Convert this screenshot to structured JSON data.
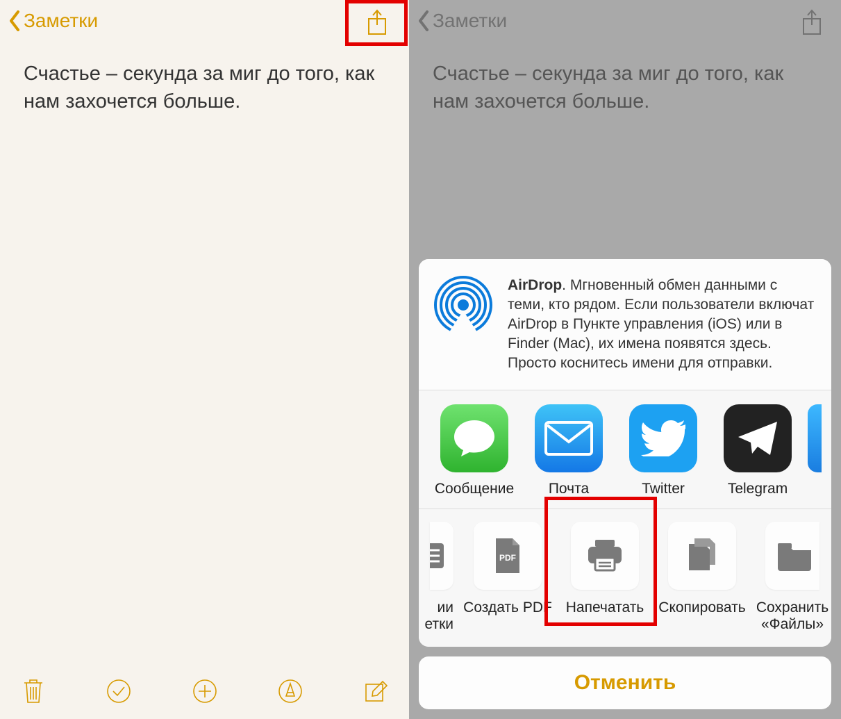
{
  "colors": {
    "accent": "#d79a00",
    "highlight": "#e30000"
  },
  "left": {
    "back_label": "Заметки",
    "note_text": "Счастье – секунда за миг до того, как нам захочется больше."
  },
  "right": {
    "back_label": "Заметки",
    "note_text": "Счастье – секунда за миг до того, как нам захочется больше."
  },
  "sheet": {
    "airdrop": {
      "title": "AirDrop",
      "desc": ". Мгновенный обмен данными с теми, кто рядом. Если пользователи включат AirDrop в Пункте управления (iOS) или в Finder (Mac), их имена появятся здесь. Просто коснитесь имени для отправки."
    },
    "apps": [
      {
        "id": "messages",
        "label": "Сообщение"
      },
      {
        "id": "mail",
        "label": "Почта"
      },
      {
        "id": "twitter",
        "label": "Twitter"
      },
      {
        "id": "telegram",
        "label": "Telegram"
      }
    ],
    "actions_trunc_left": {
      "label_line1": "ии",
      "label_line2": "етки"
    },
    "actions": [
      {
        "id": "create-pdf",
        "label": "Создать PDF"
      },
      {
        "id": "print",
        "label": "Напечатать"
      },
      {
        "id": "copy",
        "label": "Скопировать"
      }
    ],
    "actions_trunc_right": {
      "label_line1": "Сохранить",
      "label_line2": "«Файлы»"
    },
    "cancel": "Отменить"
  }
}
